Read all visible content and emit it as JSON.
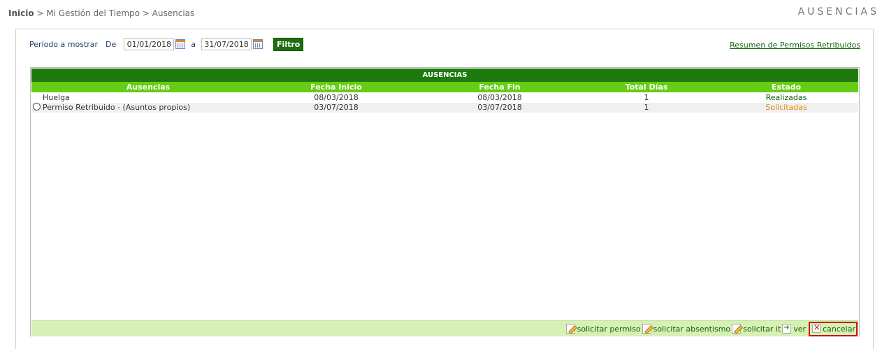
{
  "breadcrumb": {
    "home": "Inicio",
    "rest": " > Mi Gestión del Tiempo > Ausencias"
  },
  "page_title": "AUSENCIAS",
  "filter": {
    "period_label": "Período a mostrar",
    "from_label": "De",
    "from_value": "01/01/2018",
    "to_label": "a",
    "to_value": "31/07/2018",
    "button": "Filtro",
    "calendar_icon": "calendar-icon"
  },
  "summary_link": "Resumen de Permisos Retribuidos",
  "table": {
    "caption": "AUSENCIAS",
    "headers": [
      "Ausencias",
      "Fecha Inicio",
      "Fecha Fin",
      "Total Días",
      "Estado"
    ],
    "rows": [
      {
        "ausencia": "Huelga",
        "inicio": "08/03/2018",
        "fin": "08/03/2018",
        "dias": "1",
        "estado": "Realizadas",
        "selectable": false
      },
      {
        "ausencia": "Permiso Retribuido - (Asuntos propios)",
        "inicio": "03/07/2018",
        "fin": "03/07/2018",
        "dias": "1",
        "estado": "Solicitadas",
        "selectable": true
      }
    ]
  },
  "actions": {
    "solicitar_permiso": "solicitar permiso",
    "solicitar_absentismo": "solicitar absentismo",
    "solicitar_it": "solicitar it",
    "ver": "ver",
    "cancelar": "cancelar"
  },
  "colors": {
    "header_dark_green": "#1e7a0f",
    "header_light_green": "#66cc14",
    "action_bar": "#d6f0b6",
    "status_realizadas": "#17620c",
    "status_solicitadas": "#e08a0c",
    "highlight_border": "#d01010"
  }
}
